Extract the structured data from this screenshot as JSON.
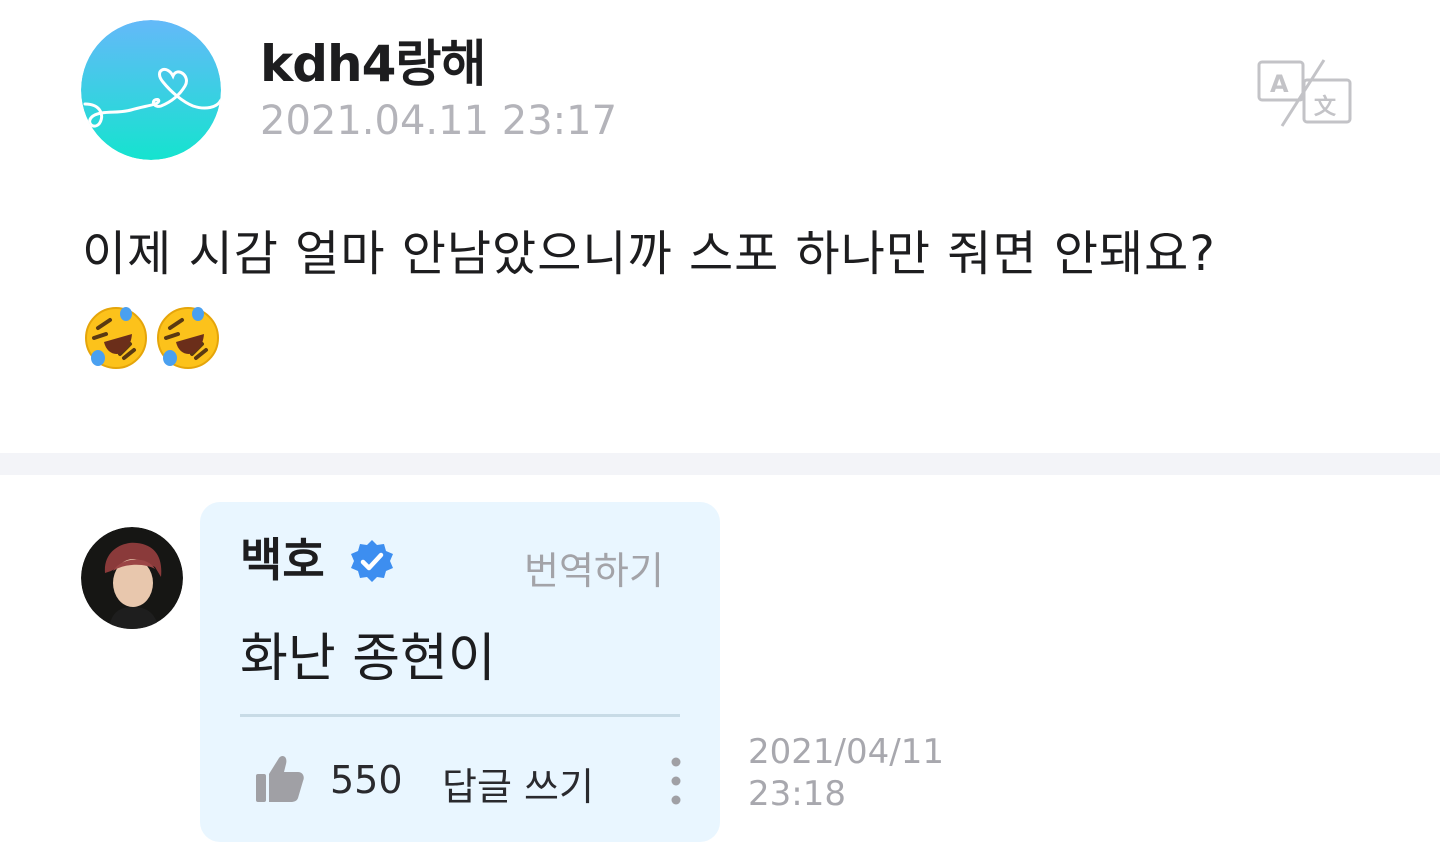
{
  "post": {
    "author": "kdh4랑해",
    "timestamp": "2021.04.11 23:17",
    "body": "이제 시감 얼마 안남았으니까 스포 하나만 줘면 안돼요?",
    "emojis": [
      "rolling-on-floor-laughing",
      "rolling-on-floor-laughing"
    ],
    "translate_icon": "translate-icon"
  },
  "comment": {
    "author": "백호",
    "verified_icon": "verified-badge-icon",
    "translate_label": "번역하기",
    "text": "화난 종현이",
    "like_count": "550",
    "reply_label": "답글 쓰기",
    "more_icon": "more-vertical-icon",
    "date": "2021/04/11",
    "time": "23:18"
  },
  "colors": {
    "bubble_bg": "#e9f6ff",
    "divider": "#f3f4f8",
    "muted_text": "#b4b4ba",
    "verified_blue": "#3d8ef0",
    "avatar_gradient_top": "#64b9f9",
    "avatar_gradient_bottom": "#15e3cf"
  }
}
